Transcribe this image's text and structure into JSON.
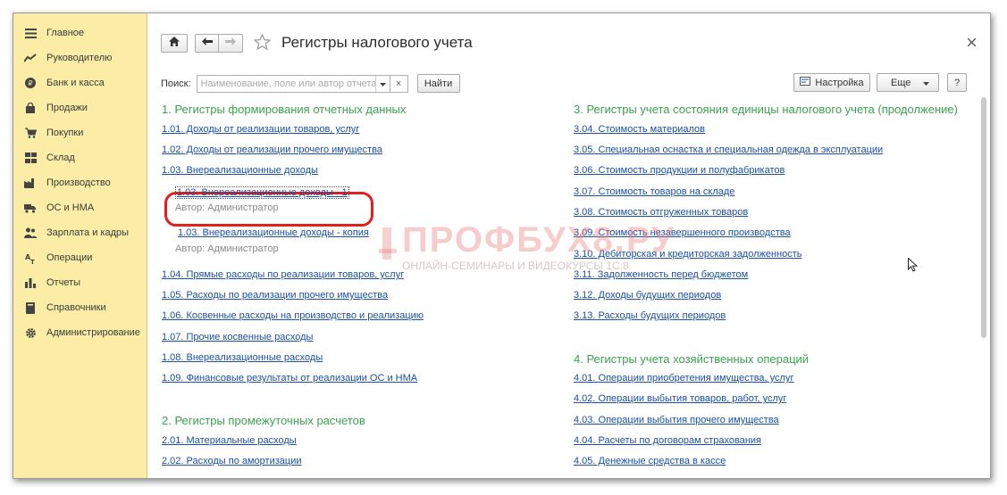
{
  "sidebar": {
    "items": [
      {
        "label": "Главное",
        "icon": "menu-lines-icon"
      },
      {
        "label": "Руководителю",
        "icon": "trend-line-icon"
      },
      {
        "label": "Банк и касса",
        "icon": "ruble-coin-icon"
      },
      {
        "label": "Продажи",
        "icon": "shopping-bag-icon"
      },
      {
        "label": "Покупки",
        "icon": "cart-icon"
      },
      {
        "label": "Склад",
        "icon": "warehouse-grid-icon"
      },
      {
        "label": "Производство",
        "icon": "factory-icon"
      },
      {
        "label": "ОС и НМА",
        "icon": "truck-icon"
      },
      {
        "label": "Зарплата и кадры",
        "icon": "people-icon"
      },
      {
        "label": "Операции",
        "icon": "operations-icon"
      },
      {
        "label": "Отчеты",
        "icon": "bar-chart-icon"
      },
      {
        "label": "Справочники",
        "icon": "book-icon"
      },
      {
        "label": "Администрирование",
        "icon": "gear-icon"
      }
    ]
  },
  "header": {
    "title": "Регистры налогового учета",
    "home_icon": "home-icon",
    "back_icon": "arrow-left-icon",
    "forward_icon": "arrow-right-icon",
    "favorite_icon": "star-icon",
    "close_icon": "close-icon"
  },
  "search": {
    "label": "Поиск:",
    "placeholder": "Наименование, поле или автор отчета",
    "value": "",
    "clear": "×",
    "find_label": "Найти"
  },
  "tools": {
    "settings_label": "Настройка",
    "more_label": "Еще",
    "help_label": "?"
  },
  "left": {
    "section1_title": "1. Регистры формирования отчетных данных",
    "section1": [
      "1.01. Доходы от реализации товаров, услуг",
      "1.02. Доходы от реализации прочего имущества",
      "1.03. Внереализационные доходы"
    ],
    "variant1": {
      "label": "1.03. Внереализационные доходы - 1",
      "author": "Автор: Администратор"
    },
    "variant2": {
      "label": "1.03. Внереализационные доходы - копия",
      "author": "Автор: Администратор"
    },
    "section1_rest": [
      "1.04. Прямые расходы по реализации товаров, услуг",
      "1.05. Расходы по реализации прочего имущества",
      "1.06. Косвенные расходы на производство и реализацию",
      "1.07. Прочие косвенные расходы",
      "1.08. Внереализационные расходы",
      "1.09. Финансовые результаты от реализации ОС и НМА"
    ],
    "section2_title": "2. Регистры промежуточных расчетов",
    "section2": [
      "2.01. Материальные расходы",
      "2.02. Расходы по амортизации"
    ]
  },
  "right": {
    "section3_title": "3. Регистры учета состояния единицы налогового учета (продолжение)",
    "section3": [
      "3.04. Стоимость материалов",
      "3.05. Специальная оснастка и специальная одежда в эксплуатации",
      "3.06. Стоимость продукции и полуфабрикатов",
      "3.07. Стоимость товаров на складе",
      "3.08. Стоимость отгруженных товаров",
      "3.09. Стоимость незавершенного производства",
      "3.10. Дебиторская и кредиторская задолженность",
      "3.11. Задолженность перед бюджетом",
      "3.12. Доходы будущих периодов",
      "3.13. Расходы будущих периодов"
    ],
    "section4_title": "4. Регистры учета хозяйственных операций",
    "section4": [
      "4.01. Операции приобретения имущества, услуг",
      "4.02. Операции выбытия товаров, работ, услуг",
      "4.03. Операции выбытия прочего имущества",
      "4.04. Расчеты по договорам страхования",
      "4.05. Денежные средства в кассе"
    ]
  },
  "watermark": {
    "title": "ПРОФБУХ8.РУ",
    "subtitle": "ОНЛАЙН-СЕМИНАРЫ И ВИДЕОКУРСЫ 1С:8"
  },
  "colors": {
    "sidebar_bg": "#fbeda5",
    "section_title": "#3aa250",
    "link": "#1a4fa3",
    "highlight": "#e0201c"
  }
}
